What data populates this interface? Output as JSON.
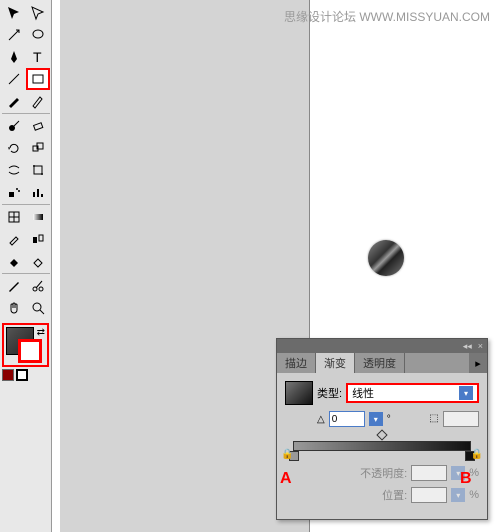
{
  "watermark": {
    "text": "思缘设计论坛 WWW.MISSYUAN.COM"
  },
  "tools": [
    "selection",
    "direct-selection",
    "magic-wand",
    "lasso",
    "pen",
    "type",
    "line",
    "rectangle",
    "paintbrush",
    "pencil",
    "blob",
    "eraser",
    "rotate",
    "scale",
    "warp",
    "free-transform",
    "symbol-sprayer",
    "graph",
    "mesh",
    "gradient",
    "eyedropper",
    "blend",
    "live-paint",
    "live-select",
    "slice",
    "scissors",
    "hand",
    "zoom"
  ],
  "sel_tool": "rectangle",
  "panel": {
    "tabs": [
      "描边",
      "渐变",
      "透明度"
    ],
    "active_tab": 1,
    "type_label": "类型:",
    "type_value": "线性",
    "angle_label": "△",
    "angle_value": "0",
    "deg": "°",
    "unit": "%",
    "ratio_value": "",
    "opacity_label": "不透明度:",
    "opacity_value": "",
    "location_label": "位置:",
    "location_value": ""
  },
  "callouts": {
    "a": "A",
    "b": "B"
  },
  "icons": {
    "close": "×",
    "menu": "▸",
    "dropdown": "▾",
    "lock": "🔒",
    "link": "⇄",
    "diamond": "◇"
  }
}
